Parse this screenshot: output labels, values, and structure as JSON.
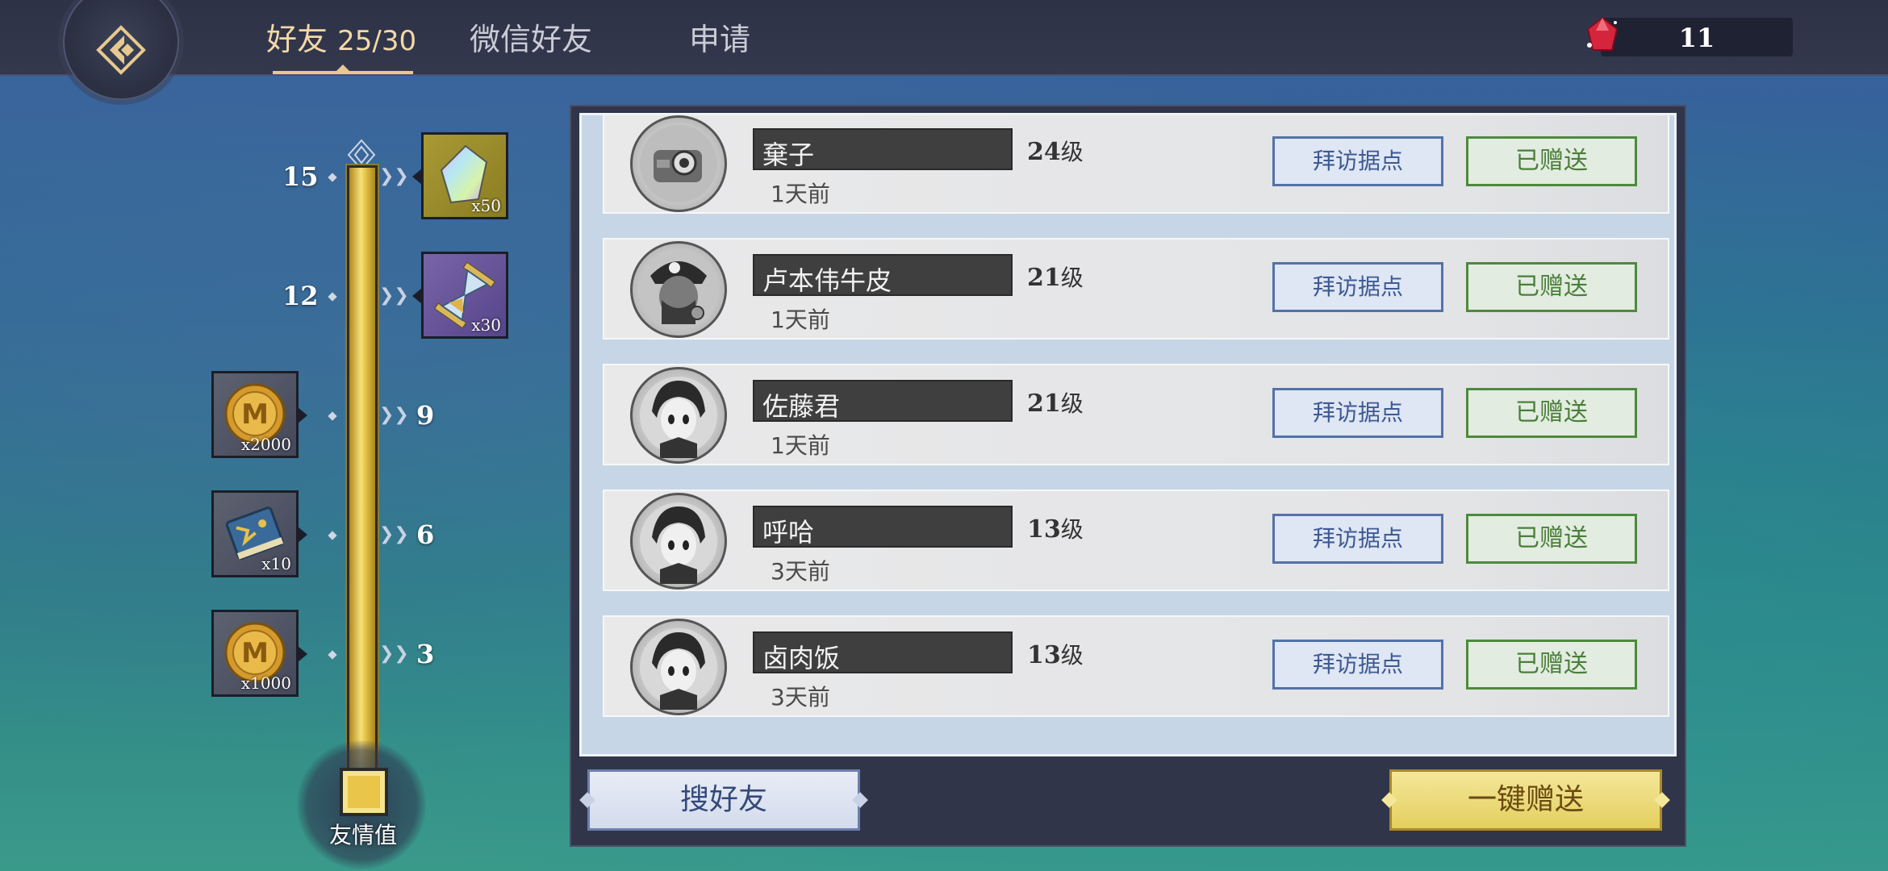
{
  "tabs": {
    "friends_label": "好友",
    "friends_count": "25/30",
    "wechat_label": "微信好友",
    "requests_label": "申请"
  },
  "currency": {
    "value": "11",
    "icon": "red-gem-icon"
  },
  "track": {
    "label": "友情值",
    "ticks": [
      {
        "value": "15",
        "reward_icon": "rainbow-crystal-icon",
        "qty": "x50",
        "side": "right"
      },
      {
        "value": "12",
        "reward_icon": "hourglass-icon",
        "qty": "x30",
        "side": "right"
      },
      {
        "value": "9",
        "reward_icon": "gold-coin-icon",
        "qty": "x2000",
        "side": "left"
      },
      {
        "value": "6",
        "reward_icon": "book-icon",
        "qty": "x10",
        "side": "left"
      },
      {
        "value": "3",
        "reward_icon": "gold-coin-icon",
        "qty": "x1000",
        "side": "left"
      }
    ]
  },
  "friends": [
    {
      "name": "棄子",
      "level": "24",
      "level_unit": "级",
      "last_seen": "1天前",
      "visit_label": "拜访据点",
      "gift_label": "已赠送"
    },
    {
      "name": "卢本伟牛皮",
      "level": "21",
      "level_unit": "级",
      "last_seen": "1天前",
      "visit_label": "拜访据点",
      "gift_label": "已赠送"
    },
    {
      "name": "佐藤君",
      "level": "21",
      "level_unit": "级",
      "last_seen": "1天前",
      "visit_label": "拜访据点",
      "gift_label": "已赠送"
    },
    {
      "name": "呼哈",
      "level": "13",
      "level_unit": "级",
      "last_seen": "3天前",
      "visit_label": "拜访据点",
      "gift_label": "已赠送"
    },
    {
      "name": "卤肉饭",
      "level": "13",
      "level_unit": "级",
      "last_seen": "3天前",
      "visit_label": "拜访据点",
      "gift_label": "已赠送"
    }
  ],
  "actions": {
    "search_label": "搜好友",
    "gift_all_label": "一键赠送"
  },
  "colors": {
    "accent_gold": "#e7c98f",
    "visit_blue": "#5372a8",
    "sent_green": "#4d8a3c",
    "gift_all_yellow": "#f4e79a"
  }
}
